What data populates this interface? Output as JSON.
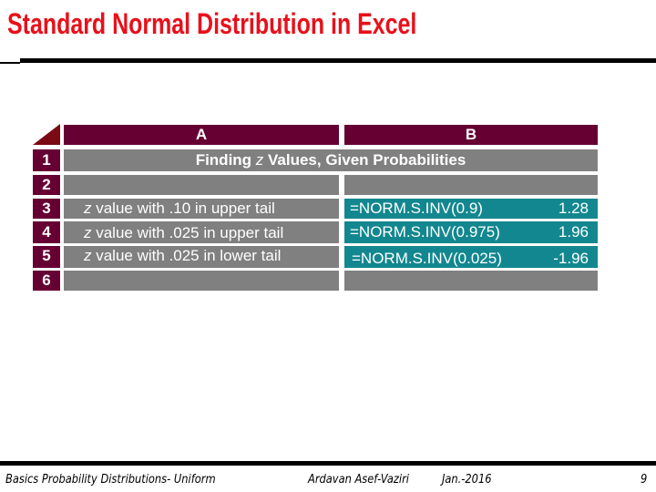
{
  "slide": {
    "title": "Standard Normal Distribution in Excel",
    "title_color": "#e8101a"
  },
  "spreadsheet": {
    "colors": {
      "header_bg": "#660033",
      "cell_bg": "#808080",
      "highlight_bg": "#13878f",
      "text": "#ffffff"
    },
    "columns": [
      "A",
      "B"
    ],
    "rows": [
      {
        "num": "1",
        "a_prefix": "Finding ",
        "a_z": "z",
        "a_suffix": " Values, Given Probabilities",
        "formula": "",
        "value": ""
      },
      {
        "num": "2",
        "a_z": "",
        "a_suffix": "",
        "formula": "",
        "value": ""
      },
      {
        "num": "3",
        "a_z": "z",
        "a_suffix": " value with .10 in upper tail",
        "formula": "=NORM.S.INV(0.9)",
        "value": "1.28"
      },
      {
        "num": "4",
        "a_z": "z",
        "a_suffix": " value with .025 in upper tail",
        "formula": "=NORM.S.INV(0.975)",
        "value": "1.96"
      },
      {
        "num": "5",
        "a_z": "z",
        "a_suffix": " value with .025 in lower tail",
        "formula": "=NORM.S.INV(0.025)",
        "value": "-1.96"
      },
      {
        "num": "6",
        "a_z": "",
        "a_suffix": "",
        "formula": "",
        "value": ""
      }
    ]
  },
  "footer": {
    "course": "Basics Probability Distributions- Uniform",
    "author": "Ardavan Asef-Vaziri",
    "date": "Jan.-2016",
    "page": "9"
  }
}
